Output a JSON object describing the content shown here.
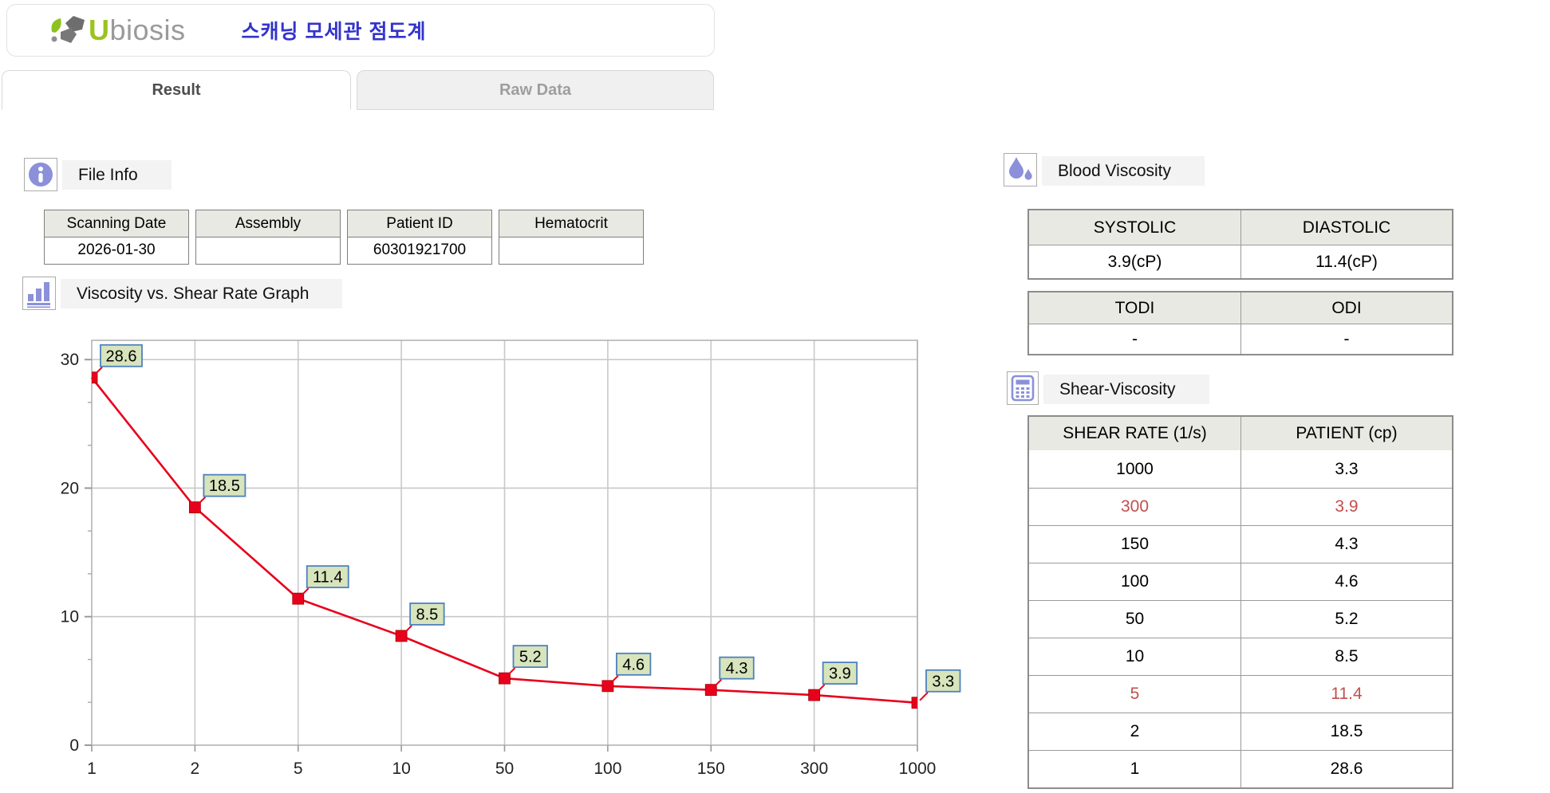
{
  "header": {
    "logo_text_u": "U",
    "logo_text_rest": "biosis",
    "app_title": "스캐닝 모세관 점도계"
  },
  "tabs": [
    {
      "label": "Result",
      "active": true
    },
    {
      "label": "Raw Data",
      "active": false
    }
  ],
  "file_info": {
    "title": "File Info",
    "fields": [
      {
        "label": "Scanning Date",
        "value": "2026-01-30"
      },
      {
        "label": "Assembly",
        "value": ""
      },
      {
        "label": "Patient ID",
        "value": "60301921700"
      },
      {
        "label": "Hematocrit",
        "value": ""
      }
    ]
  },
  "graph_section": {
    "title": "Viscosity vs. Shear Rate Graph"
  },
  "chart_data": {
    "type": "line",
    "title": "Viscosity vs. Shear Rate Graph",
    "categories": [
      "1",
      "2",
      "5",
      "10",
      "50",
      "100",
      "150",
      "300",
      "1000"
    ],
    "values": [
      28.6,
      18.5,
      11.4,
      8.5,
      5.2,
      4.6,
      4.3,
      3.9,
      3.3
    ],
    "data_labels": [
      "28.6",
      "18.5",
      "11.4",
      "8.5",
      "5.2",
      "4.6",
      "4.3",
      "3.9",
      "3.3"
    ],
    "xlabel": "",
    "ylabel": "",
    "ylim": [
      0,
      31.5
    ],
    "yticks": [
      0,
      10,
      20,
      30
    ],
    "y_minor_step": 3.3333,
    "grid": true,
    "legend": false,
    "line_color": "#e8001c",
    "marker": "square",
    "marker_color": "#e8001c",
    "label_box_fill": "#d7e4bc",
    "label_box_border": "#4f81bd"
  },
  "blood_viscosity": {
    "title": "Blood Viscosity",
    "pressure_table": {
      "headers": [
        "SYSTOLIC",
        "DIASTOLIC"
      ],
      "values": [
        "3.9(cP)",
        "11.4(cP)"
      ]
    },
    "index_table": {
      "headers": [
        "TODI",
        "ODI"
      ],
      "values": [
        "-",
        "-"
      ]
    }
  },
  "shear_viscosity": {
    "title": "Shear-Viscosity",
    "headers": [
      "SHEAR RATE (1/s)",
      "PATIENT (cp)"
    ],
    "rows": [
      {
        "shear_rate": "1000",
        "patient": "3.3",
        "highlight": false
      },
      {
        "shear_rate": "300",
        "patient": "3.9",
        "highlight": true
      },
      {
        "shear_rate": "150",
        "patient": "4.3",
        "highlight": false
      },
      {
        "shear_rate": "100",
        "patient": "4.6",
        "highlight": false
      },
      {
        "shear_rate": "50",
        "patient": "5.2",
        "highlight": false
      },
      {
        "shear_rate": "10",
        "patient": "8.5",
        "highlight": false
      },
      {
        "shear_rate": "5",
        "patient": "11.4",
        "highlight": true
      },
      {
        "shear_rate": "2",
        "patient": "18.5",
        "highlight": false
      },
      {
        "shear_rate": "1",
        "patient": "28.6",
        "highlight": false
      }
    ]
  },
  "colors": {
    "accent_blue": "#3333cc",
    "icon_purple": "#8b90d9",
    "highlight_red": "#c0504d",
    "chart_line": "#e8001c",
    "grid_gray": "#c9c9c9",
    "table_header_bg": "#e9e9e3"
  }
}
